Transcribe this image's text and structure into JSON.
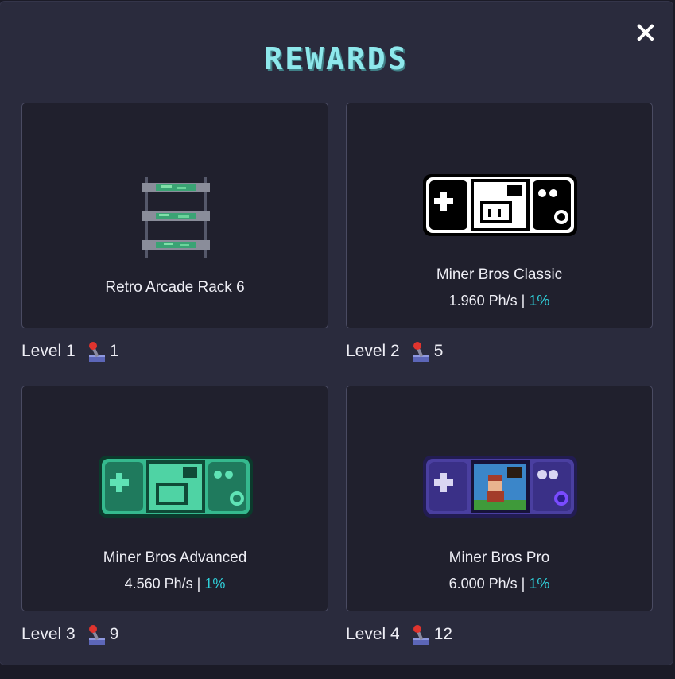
{
  "modal": {
    "title": "REWARDS",
    "close_icon": "close-icon"
  },
  "rewards": [
    {
      "level_label": "Level 1",
      "count": "1",
      "name": "Retro Arcade Rack 6",
      "hashrate": "",
      "sep": "",
      "bonus": "",
      "art": "rack-icon"
    },
    {
      "level_label": "Level 2",
      "count": "5",
      "name": "Miner Bros Classic",
      "hashrate": "1.960 Ph/s",
      "sep": " | ",
      "bonus": "1%",
      "art": "handheld-classic-icon"
    },
    {
      "level_label": "Level 3",
      "count": "9",
      "name": "Miner Bros Advanced",
      "hashrate": "4.560 Ph/s",
      "sep": " | ",
      "bonus": "1%",
      "art": "handheld-advanced-icon"
    },
    {
      "level_label": "Level 4",
      "count": "12",
      "name": "Miner Bros Pro",
      "hashrate": "6.000 Ph/s",
      "sep": " | ",
      "bonus": "1%",
      "art": "handheld-pro-icon"
    }
  ],
  "colors": {
    "accent": "#8ee8ec",
    "bonus": "#2fd0da",
    "panel": "#2a2b3d",
    "card": "#20202d"
  }
}
